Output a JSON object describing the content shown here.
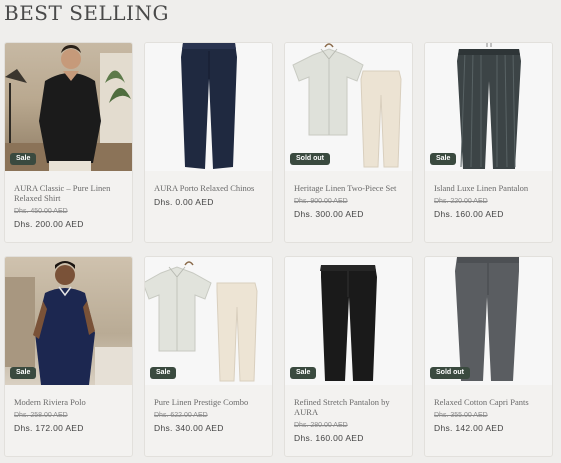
{
  "section": {
    "title": "BEST SELLING"
  },
  "products": [
    {
      "name": "AURA Classic – Pure Linen Relaxed Shirt",
      "badge": "Sale",
      "old_price": "Dhs. 450.00 AED",
      "price": "Dhs. 200.00 AED",
      "image": "model-black-shirt"
    },
    {
      "name": "AURA Porto Relaxed Chinos",
      "badge": "",
      "old_price": "",
      "price": "Dhs. 0.00 AED",
      "image": "navy-chinos"
    },
    {
      "name": "Heritage Linen Two-Piece Set",
      "badge": "Sold out",
      "old_price": "Dhs. 900.00 AED",
      "price": "Dhs. 300.00 AED",
      "image": "linen-shirt-and-pants"
    },
    {
      "name": "Island Luxe Linen Pantalon",
      "badge": "Sale",
      "old_price": "Dhs. 220.00 AED",
      "price": "Dhs. 160.00 AED",
      "image": "dark-striped-pants"
    },
    {
      "name": "Modern Riviera Polo",
      "badge": "Sale",
      "old_price": "Dhs. 258.00 AED",
      "price": "Dhs. 172.00 AED",
      "image": "model-navy-polo"
    },
    {
      "name": "Pure Linen Prestige Combo",
      "badge": "Sale",
      "old_price": "Dhs. 622.00 AED",
      "price": "Dhs. 340.00 AED",
      "image": "linen-shirt-and-pants"
    },
    {
      "name": "Refined Stretch Pantalon by AURA",
      "badge": "Sale",
      "old_price": "Dhs. 280.00 AED",
      "price": "Dhs. 160.00 AED",
      "image": "black-pants"
    },
    {
      "name": "Relaxed Cotton Capri Pants",
      "badge": "Sold out",
      "old_price": "Dhs. 355.00 AED",
      "price": "Dhs. 142.00 AED",
      "image": "grey-pants"
    }
  ],
  "colors": {
    "badge_bg": "#3a4a3f",
    "page_bg": "#efeeec",
    "card_bg": "#f3f2f0"
  }
}
